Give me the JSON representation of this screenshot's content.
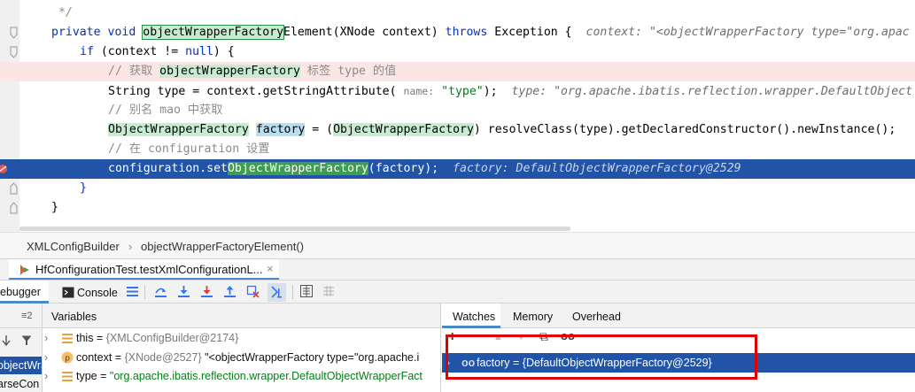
{
  "editor": {
    "lines": {
      "l1": {
        "text": "*/"
      },
      "l2": {
        "kw_private": "private",
        "kw_void": "void",
        "method_name": "objectWrapperFactory",
        "method_rest": "Element(XNode context)",
        "kw_throws": "throws",
        "exception": "Exception {",
        "hint": "context: \"<objectWrapperFactory type=\"org.apac"
      },
      "l3": {
        "kw_if": "if",
        "open": "(context != ",
        "kw_null": "null",
        "close": ") {"
      },
      "l4": {
        "comment_prefix": "// 获取 ",
        "comment_hl": "objectWrapperFactory",
        "comment_suffix": " 标签 type 的值"
      },
      "l5": {
        "code": "String type = context.getStringAttribute(",
        "param": "name:",
        "str": "\"type\"",
        "end": ");",
        "hint": "type: \"org.apache.ibatis.reflection.wrapper.DefaultObject"
      },
      "l6": {
        "comment": "// 别名 mao 中获取"
      },
      "l7": {
        "type_hl": "ObjectWrapperFactory",
        "var_hl": "factory",
        "eq": " = (",
        "cast_hl": "ObjectWrapperFactory",
        "rest": ") resolveClass(type).getDeclaredConstructor().newInstance();"
      },
      "l8": {
        "comment": "// 在 configuration 设置"
      },
      "l9": {
        "prefix": "configuration.set",
        "hl": "ObjectWrapperFactory",
        "suffix": "(factory);",
        "hint": "factory: DefaultObjectWrapperFactory@2529"
      },
      "l10": {
        "text": "}"
      },
      "l11": {
        "text": "}"
      }
    }
  },
  "breadcrumb": {
    "class_name": "XMLConfigBuilder",
    "separator": "›",
    "method_name": "objectWrapperFactoryElement()"
  },
  "debug_tab": {
    "session_label": "HfConfigurationTest.testXmlConfigurationL...",
    "close": "×"
  },
  "toolbar": {
    "debugger_label": "ebugger",
    "console_label": "Console"
  },
  "frames": {
    "filter_label": "≡2",
    "item1": "objectWra",
    "item2": "arseCon"
  },
  "variables": {
    "header": "Variables",
    "rows": [
      {
        "name": "this",
        "eq": " = ",
        "value": "{XMLConfigBuilder@2174}",
        "extra": ""
      },
      {
        "name": "context",
        "eq": " = ",
        "value": "{XNode@2527}",
        "extra": " \"<objectWrapperFactory type=\"org.apache.i"
      },
      {
        "name": "type",
        "eq": " = ",
        "value": "\"org.apache.ibatis.reflection.wrapper.DefaultObjectWrapperFact",
        "extra": ""
      }
    ]
  },
  "watches": {
    "tabs": [
      "Watches",
      "Memory",
      "Overhead"
    ],
    "toolbar_glyphs": {
      "add": "+",
      "remove": "−",
      "up": "▲",
      "down": "▼",
      "copy": "⧉",
      "glasses": "oo"
    },
    "entry": {
      "glyph": "oo",
      "name": "factory",
      "eq": " = ",
      "value": "{DefaultObjectWrapperFactory@2529}"
    }
  },
  "colors": {
    "current_line": "#2154a6",
    "selection_blue": "#2154a6",
    "highlight_green": "#c7ecd1",
    "annotation_red": "#e00000"
  }
}
